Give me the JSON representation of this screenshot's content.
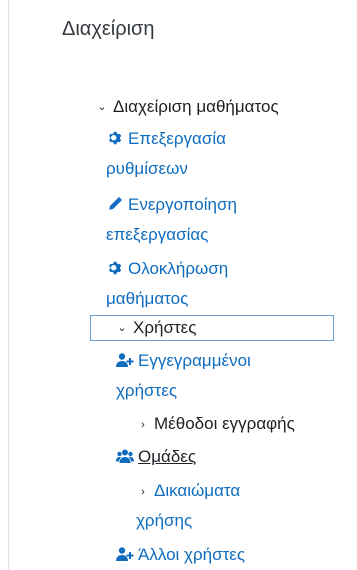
{
  "block": {
    "title": "Διαχείριση"
  },
  "tree": {
    "course_admin": {
      "label": "Διαχείριση μαθήματος"
    },
    "edit_settings": {
      "line1": "Επεξεργασία",
      "line2": "ρυθμίσεων",
      "icon": "gear-icon"
    },
    "turn_editing_on": {
      "line1": "Ενεργοποίηση",
      "line2": "επεξεργασίας",
      "icon": "pencil-icon"
    },
    "course_completion": {
      "line1": "Ολοκλήρωση",
      "line2": "μαθήματος",
      "icon": "gear-icon"
    },
    "users": {
      "label": "Χρήστες"
    },
    "enrolled_users": {
      "line1": "Εγγεγραμμένοι",
      "line2": "χρήστες",
      "icon": "user-plus-icon"
    },
    "enrolment_methods": {
      "label": "Μέθοδοι εγγραφής"
    },
    "groups": {
      "label": "Ομάδες",
      "icon": "users-icon"
    },
    "permissions": {
      "line1": "Δικαιώματα",
      "line2": "χρήσης"
    },
    "other_users": {
      "label": "Άλλοι χρήστες",
      "icon": "user-plus-icon"
    }
  },
  "colors": {
    "link": "#0f6cbf",
    "text": "#1d2125",
    "selected_border": "#6ea0d8"
  }
}
